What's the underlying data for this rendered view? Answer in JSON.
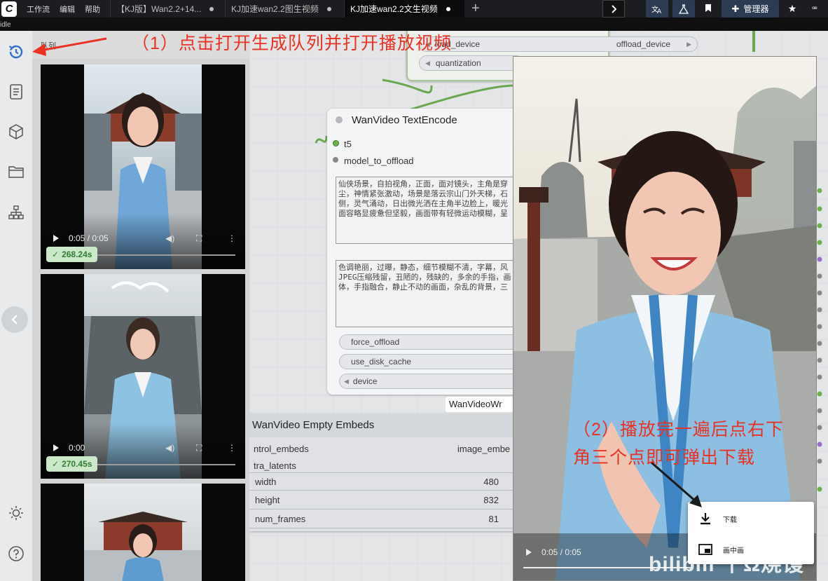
{
  "app": {
    "menus": [
      "工作流",
      "编辑",
      "帮助"
    ],
    "subbar_text": "idle"
  },
  "tabs": [
    {
      "label": "【KJ版】Wan2.2+14..."
    },
    {
      "label": "KJ加速wan2.2图生视频"
    },
    {
      "label": "KJ加速wan2.2文生视频"
    }
  ],
  "topbar": {
    "manager_label": "管理器",
    "icons": [
      "chevron-right-icon",
      "translate-icon",
      "flask-icon",
      "bookmark-icon",
      "puzzle-icon",
      "star-icon",
      "cursor-icon"
    ]
  },
  "rail": {
    "icons": [
      "history-icon",
      "document-icon",
      "cube-icon",
      "folder-icon",
      "sitemap-icon",
      "sun-icon",
      "help-icon"
    ]
  },
  "queue": {
    "title": "队列",
    "items": [
      {
        "time": "0:05 / 0:05",
        "duration": "268.24s"
      },
      {
        "time": "0:00",
        "duration": "270.45s"
      },
      {
        "time": "",
        "duration": ""
      }
    ]
  },
  "nodes": {
    "top_pills": {
      "load_device": "load_device",
      "offload_device": "offload_device",
      "quantization": "quantization"
    },
    "text_encode": {
      "title": "WanVideo TextEncode",
      "inputs": [
        "t5",
        "model_to_offload"
      ],
      "positive_prompt": "仙侠场景，自拍视角，正面，面对镜头，主角是穿\n尘，神情紧张激动，场景是落云宗山门外天梯，石\n侧，灵气涌动，日出微光洒在主角半边脸上，暖光\n面容略显疲惫但坚毅，画面带有轻微运动模糊，呈",
      "negative_prompt": "色调艳丽，过曝，静态，细节模糊不清，字幕，风\nJPEG压缩残留，丑陋的，残缺的，多余的手指，画\n体，手指融合，静止不动的画面，杂乱的背景，三",
      "widgets": [
        "force_offload",
        "use_disk_cache",
        "device"
      ]
    },
    "wrapper_label": "WanVideoWr",
    "empty_embeds": {
      "title": "WanVideo Empty Embeds",
      "inputs": [
        {
          "left": "ntrol_embeds",
          "right": "image_embe"
        },
        {
          "left": "tra_latents",
          "right": ""
        }
      ],
      "rows": [
        {
          "name": "width",
          "value": "480"
        },
        {
          "name": "height",
          "value": "832"
        },
        {
          "name": "num_frames",
          "value": "81"
        }
      ]
    }
  },
  "player": {
    "time": "0:05 / 0:05",
    "menu": [
      {
        "label": "下载",
        "icon": "download-icon"
      },
      {
        "label": "画中画",
        "icon": "picture-in-picture-icon"
      }
    ]
  },
  "annotations": {
    "step1": "（1）点击打开生成队列并打开播放视频",
    "step2_line1": "（2）播放完一遍后点右下",
    "step2_line2": "角三个点即可弹出下载",
    "watermark": "bilibili 千Ω烧馒"
  },
  "colors": {
    "annotation": "#ea3224",
    "badge_bg": "#cbe8c8",
    "badge_text": "#2e7d32",
    "accent_btn": "#2c3a52"
  }
}
